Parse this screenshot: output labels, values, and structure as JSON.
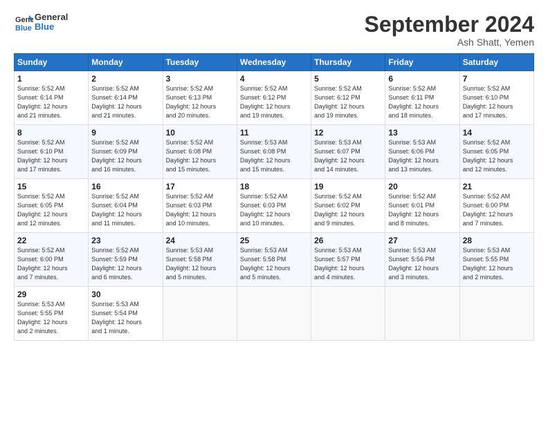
{
  "header": {
    "logo_line1": "General",
    "logo_line2": "Blue",
    "month_title": "September 2024",
    "location": "Ash Shatt, Yemen"
  },
  "weekdays": [
    "Sunday",
    "Monday",
    "Tuesday",
    "Wednesday",
    "Thursday",
    "Friday",
    "Saturday"
  ],
  "weeks": [
    [
      {
        "day": "1",
        "info": "Sunrise: 5:52 AM\nSunset: 6:14 PM\nDaylight: 12 hours\nand 21 minutes."
      },
      {
        "day": "2",
        "info": "Sunrise: 5:52 AM\nSunset: 6:14 PM\nDaylight: 12 hours\nand 21 minutes."
      },
      {
        "day": "3",
        "info": "Sunrise: 5:52 AM\nSunset: 6:13 PM\nDaylight: 12 hours\nand 20 minutes."
      },
      {
        "day": "4",
        "info": "Sunrise: 5:52 AM\nSunset: 6:12 PM\nDaylight: 12 hours\nand 19 minutes."
      },
      {
        "day": "5",
        "info": "Sunrise: 5:52 AM\nSunset: 6:12 PM\nDaylight: 12 hours\nand 19 minutes."
      },
      {
        "day": "6",
        "info": "Sunrise: 5:52 AM\nSunset: 6:11 PM\nDaylight: 12 hours\nand 18 minutes."
      },
      {
        "day": "7",
        "info": "Sunrise: 5:52 AM\nSunset: 6:10 PM\nDaylight: 12 hours\nand 17 minutes."
      }
    ],
    [
      {
        "day": "8",
        "info": "Sunrise: 5:52 AM\nSunset: 6:10 PM\nDaylight: 12 hours\nand 17 minutes."
      },
      {
        "day": "9",
        "info": "Sunrise: 5:52 AM\nSunset: 6:09 PM\nDaylight: 12 hours\nand 16 minutes."
      },
      {
        "day": "10",
        "info": "Sunrise: 5:52 AM\nSunset: 6:08 PM\nDaylight: 12 hours\nand 15 minutes."
      },
      {
        "day": "11",
        "info": "Sunrise: 5:53 AM\nSunset: 6:08 PM\nDaylight: 12 hours\nand 15 minutes."
      },
      {
        "day": "12",
        "info": "Sunrise: 5:53 AM\nSunset: 6:07 PM\nDaylight: 12 hours\nand 14 minutes."
      },
      {
        "day": "13",
        "info": "Sunrise: 5:53 AM\nSunset: 6:06 PM\nDaylight: 12 hours\nand 13 minutes."
      },
      {
        "day": "14",
        "info": "Sunrise: 5:52 AM\nSunset: 6:05 PM\nDaylight: 12 hours\nand 12 minutes."
      }
    ],
    [
      {
        "day": "15",
        "info": "Sunrise: 5:52 AM\nSunset: 6:05 PM\nDaylight: 12 hours\nand 12 minutes."
      },
      {
        "day": "16",
        "info": "Sunrise: 5:52 AM\nSunset: 6:04 PM\nDaylight: 12 hours\nand 11 minutes."
      },
      {
        "day": "17",
        "info": "Sunrise: 5:52 AM\nSunset: 6:03 PM\nDaylight: 12 hours\nand 10 minutes."
      },
      {
        "day": "18",
        "info": "Sunrise: 5:52 AM\nSunset: 6:03 PM\nDaylight: 12 hours\nand 10 minutes."
      },
      {
        "day": "19",
        "info": "Sunrise: 5:52 AM\nSunset: 6:02 PM\nDaylight: 12 hours\nand 9 minutes."
      },
      {
        "day": "20",
        "info": "Sunrise: 5:52 AM\nSunset: 6:01 PM\nDaylight: 12 hours\nand 8 minutes."
      },
      {
        "day": "21",
        "info": "Sunrise: 5:52 AM\nSunset: 6:00 PM\nDaylight: 12 hours\nand 7 minutes."
      }
    ],
    [
      {
        "day": "22",
        "info": "Sunrise: 5:52 AM\nSunset: 6:00 PM\nDaylight: 12 hours\nand 7 minutes."
      },
      {
        "day": "23",
        "info": "Sunrise: 5:52 AM\nSunset: 5:59 PM\nDaylight: 12 hours\nand 6 minutes."
      },
      {
        "day": "24",
        "info": "Sunrise: 5:53 AM\nSunset: 5:58 PM\nDaylight: 12 hours\nand 5 minutes."
      },
      {
        "day": "25",
        "info": "Sunrise: 5:53 AM\nSunset: 5:58 PM\nDaylight: 12 hours\nand 5 minutes."
      },
      {
        "day": "26",
        "info": "Sunrise: 5:53 AM\nSunset: 5:57 PM\nDaylight: 12 hours\nand 4 minutes."
      },
      {
        "day": "27",
        "info": "Sunrise: 5:53 AM\nSunset: 5:56 PM\nDaylight: 12 hours\nand 3 minutes."
      },
      {
        "day": "28",
        "info": "Sunrise: 5:53 AM\nSunset: 5:55 PM\nDaylight: 12 hours\nand 2 minutes."
      }
    ],
    [
      {
        "day": "29",
        "info": "Sunrise: 5:53 AM\nSunset: 5:55 PM\nDaylight: 12 hours\nand 2 minutes."
      },
      {
        "day": "30",
        "info": "Sunrise: 5:53 AM\nSunset: 5:54 PM\nDaylight: 12 hours\nand 1 minute."
      },
      {
        "day": "",
        "info": ""
      },
      {
        "day": "",
        "info": ""
      },
      {
        "day": "",
        "info": ""
      },
      {
        "day": "",
        "info": ""
      },
      {
        "day": "",
        "info": ""
      }
    ]
  ]
}
